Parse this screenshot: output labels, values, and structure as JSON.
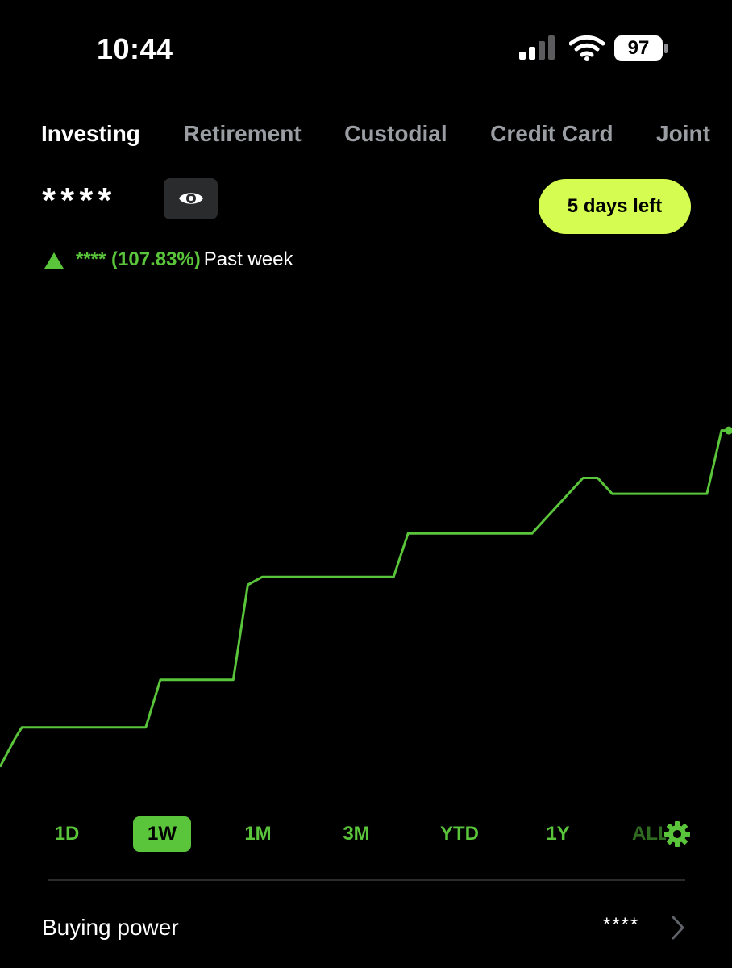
{
  "status_bar": {
    "time": "10:44",
    "battery_level": "97",
    "icons": [
      "cellular-signal-icon",
      "wifi-icon",
      "battery-icon"
    ]
  },
  "tabs": [
    {
      "label": "Investing",
      "active": true
    },
    {
      "label": "Retirement",
      "active": false
    },
    {
      "label": "Custodial",
      "active": false
    },
    {
      "label": "Credit Card",
      "active": false
    },
    {
      "label": "Joint",
      "active": false
    }
  ],
  "portfolio": {
    "balance_masked": "****",
    "visibility_icon": "eye-icon",
    "days_left_label": "5 days left",
    "change_amount_masked": "****",
    "change_percent": "(107.83%)",
    "change_period": "Past week",
    "trend_icon": "triangle-up-icon"
  },
  "chart_data": {
    "type": "line",
    "title": "",
    "xlabel": "",
    "ylabel": "",
    "x": [
      0,
      2,
      3,
      6,
      20,
      22,
      32,
      34,
      36,
      40,
      42,
      54,
      56,
      64,
      66,
      70,
      73,
      80,
      82,
      84,
      89,
      90,
      97,
      99,
      100
    ],
    "y": [
      0,
      7,
      10,
      10,
      10,
      22,
      22,
      46,
      48,
      48,
      48,
      48,
      59,
      59,
      59,
      59,
      59,
      73,
      73,
      69,
      69,
      69,
      69,
      85,
      85
    ],
    "xlim": [
      0,
      100
    ],
    "ylim": [
      -8,
      100
    ],
    "grid": false,
    "color": "#5ac53b"
  },
  "ranges": [
    {
      "label": "1D",
      "selected": false
    },
    {
      "label": "1W",
      "selected": true
    },
    {
      "label": "1M",
      "selected": false
    },
    {
      "label": "3M",
      "selected": false
    },
    {
      "label": "YTD",
      "selected": false
    },
    {
      "label": "1Y",
      "selected": false
    },
    {
      "label": "ALL",
      "selected": false,
      "truncated": true
    }
  ],
  "chart_settings_icon": "gear-icon",
  "buying_power": {
    "label": "Buying power",
    "value_masked": "****",
    "chevron_icon": "chevron-right-icon"
  },
  "colors": {
    "accent_green": "#5ac53b",
    "promo_lime": "#d5fd51",
    "background": "#000000",
    "inactive_tab": "#9a9ea3"
  }
}
